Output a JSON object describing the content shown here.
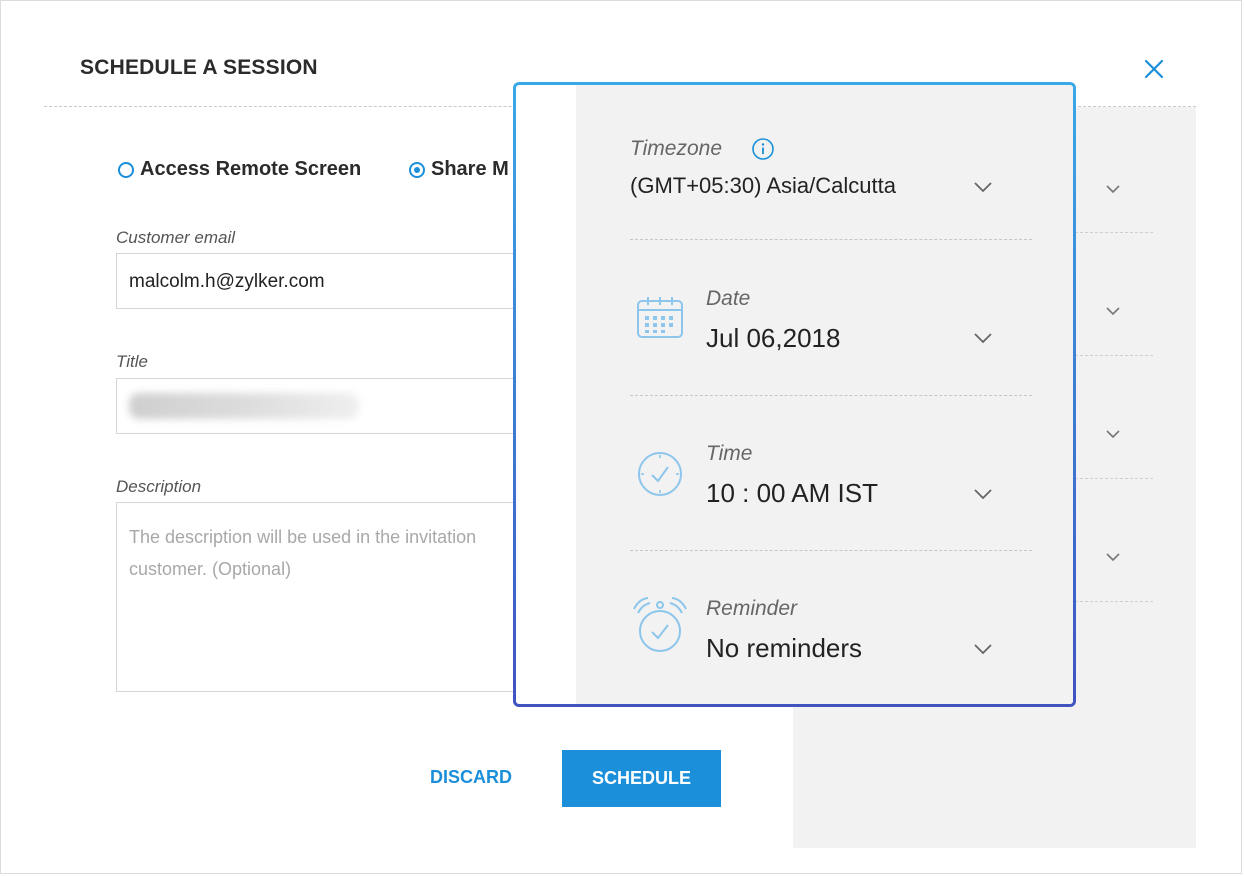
{
  "header": {
    "title": "SCHEDULE A SESSION"
  },
  "session_type": {
    "options": [
      {
        "label": "Access Remote Screen",
        "checked": false
      },
      {
        "label": "Share M",
        "checked": true
      }
    ]
  },
  "form": {
    "email_label": "Customer email",
    "email_value": "malcolm.h@zylker.com",
    "title_label": "Title",
    "description_label": "Description",
    "description_placeholder": "The description will be used in the invitation\ncustomer. (Optional)"
  },
  "actions": {
    "discard_label": "DISCARD",
    "schedule_label": "SCHEDULE"
  },
  "schedule_popover": {
    "timezone_label": "Timezone",
    "timezone_value": "(GMT+05:30) Asia/Calcutta",
    "date_label": "Date",
    "date_value": "Jul 06,2018",
    "time_label": "Time",
    "time_value": "10 : 00 AM IST",
    "reminder_label": "Reminder",
    "reminder_value": "No reminders"
  },
  "colors": {
    "accent": "#1b8fd9",
    "popover_border_top": "#3aa8e8",
    "popover_border_bottom": "#3f53c1",
    "panel_bg": "#f2f2f2"
  },
  "icons": [
    "close-icon",
    "info-icon",
    "calendar-icon",
    "clock-icon",
    "alarm-clock-icon",
    "chevron-down-icon"
  ]
}
